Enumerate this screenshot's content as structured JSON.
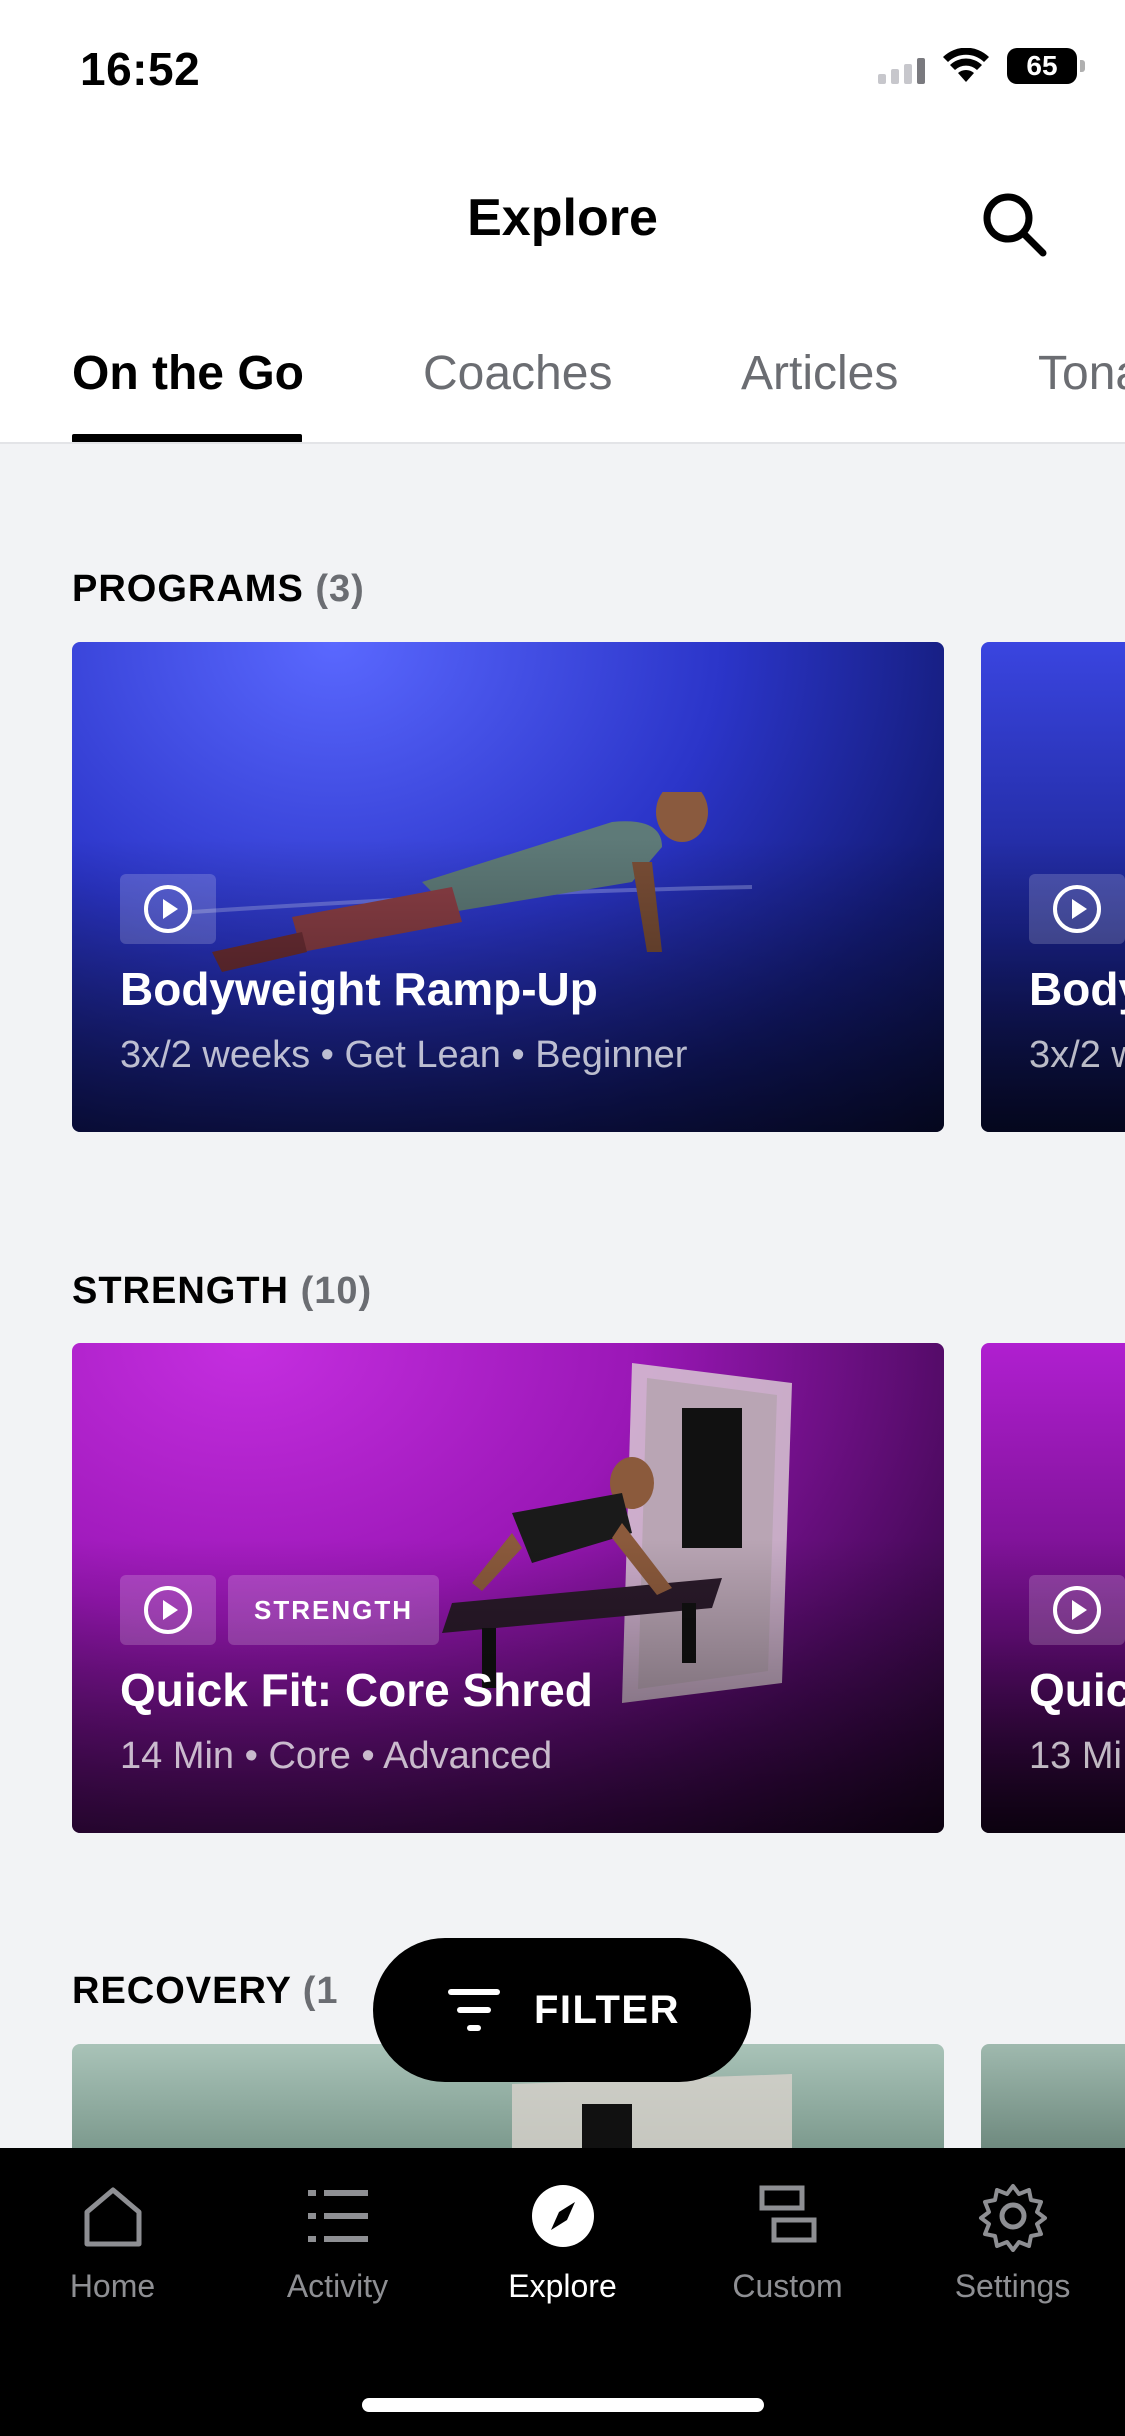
{
  "status_bar": {
    "time": "16:52",
    "battery": "65"
  },
  "header": {
    "title": "Explore"
  },
  "tabs": [
    {
      "label": "On the Go",
      "active": true
    },
    {
      "label": "Coaches",
      "active": false
    },
    {
      "label": "Articles",
      "active": false
    },
    {
      "label": "Tona",
      "active": false
    }
  ],
  "sections": {
    "programs": {
      "title": "PROGRAMS",
      "count": "(3)",
      "cards": [
        {
          "title": "Bodyweight Ramp-Up",
          "meta": "3x/2 weeks • Get Lean • Beginner"
        },
        {
          "title": "Body",
          "meta": "3x/2 w"
        }
      ]
    },
    "strength": {
      "title": "STRENGTH",
      "count": "(10)",
      "cards": [
        {
          "chip": "STRENGTH",
          "title": "Quick Fit: Core Shred",
          "meta": "14 Min • Core • Advanced"
        },
        {
          "title": "Quic",
          "meta": "13 Mi"
        }
      ]
    },
    "recovery": {
      "title": "RECOVERY",
      "count": "(1"
    }
  },
  "filter": {
    "label": "FILTER"
  },
  "nav": [
    {
      "label": "Home",
      "icon": "home-icon"
    },
    {
      "label": "Activity",
      "icon": "list-icon"
    },
    {
      "label": "Explore",
      "icon": "compass-icon",
      "active": true
    },
    {
      "label": "Custom",
      "icon": "custom-icon"
    },
    {
      "label": "Settings",
      "icon": "gear-icon"
    }
  ],
  "colors": {
    "programs_card": "#2b35c9",
    "strength_card": "#9a17b6",
    "recovery_card": "#7d9a8e",
    "nav_background": "#000000"
  }
}
